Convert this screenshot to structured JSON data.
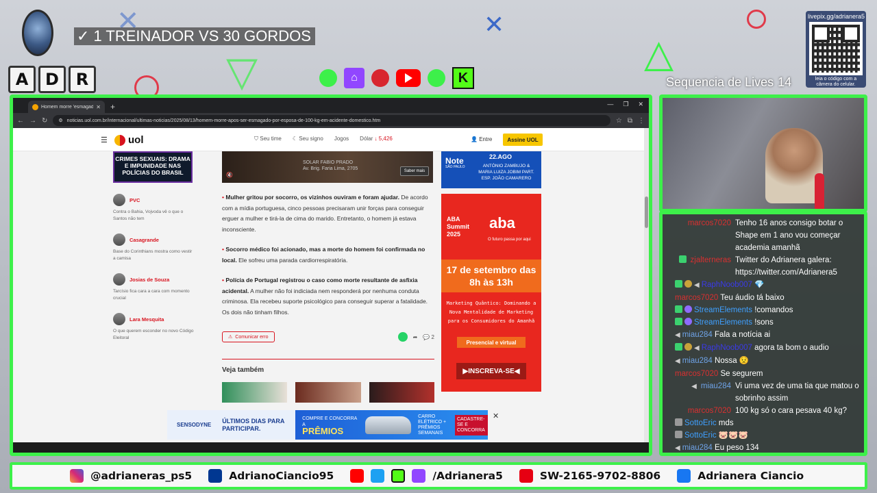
{
  "overlay": {
    "title_check": "✓",
    "title": "1 TREINADOR VS 30 GORDOS",
    "adr_letters": [
      "A",
      "D",
      "R"
    ],
    "qr_top": "livepix.gg/adrianera5",
    "qr_bottom": "leia o código com a câmera do celular.",
    "streak_label": "Sequencia de Lives",
    "streak_count": "14"
  },
  "browser": {
    "tab_title": "Homem morre 'esmagado' po",
    "url": "noticias.uol.com.br/internacional/ultimas-noticias/2025/08/13/homem-morre-apos-ser-esmagado-por-esposa-de-100-kg-em-acidente-domestico.htm"
  },
  "uol": {
    "logo": "uol",
    "nav": {
      "seu_time": "Seu time",
      "seu_signo": "Seu signo",
      "jogos": "Jogos",
      "dolar": "Dólar",
      "dolar_val": "↓ 5,426"
    },
    "entre": "Entre",
    "assine": "Assine UOL",
    "crimes_box": "CRIMES SEXUAIS: DRAMA E IMPUNIDADE NAS POLÍCIAS DO BRASIL",
    "authors": [
      {
        "name": "PVC",
        "desc": "Contra o Bahia, Vojvoda vê o que o Santos não tem"
      },
      {
        "name": "Casagrande",
        "desc": "Base do Corinthians mostra como vestir a camisa"
      },
      {
        "name": "Josias de Souza",
        "desc": "Tarcísio fica cara a cara com momento crucial"
      },
      {
        "name": "Lara Mesquita",
        "desc": "O que querem esconder no novo Código Eleitoral"
      }
    ],
    "video_caption_1": "SOLAR FABIO PRADO",
    "video_caption_2": "Av. Brig. Faria Lima, 2705",
    "saber_mais": "Saber mais",
    "p1_bold": "Mulher gritou por socorro, os vizinhos ouviram e foram ajudar.",
    "p1_rest": " De acordo com a mídia portuguesa, cinco pessoas precisaram unir forças para conseguir erguer a mulher e tirá-la de cima do marido. Entretanto, o homem já estava inconsciente.",
    "p2_bold": "Socorro médico foi acionado, mas a morte do homem foi confirmada no local.",
    "p2_rest": " Ele sofreu uma parada cardiorrespiratória.",
    "p3_bold": "Polícia de Portugal registrou o caso como morte resultante de asfixia acidental.",
    "p3_rest": " A mulher não foi indiciada nem responderá por nenhuma conduta criminosa. Ela recebeu suporte psicológico para conseguir superar a fatalidade. Os dois não tinham filhos.",
    "comunicar": "Comunicar erro",
    "comments": "2",
    "veja": "Veja também",
    "ad_note_logo": "Note",
    "ad_note_sub": "SÃO PAULO",
    "ad_note_date": "22.AGO",
    "ad_note_names": "ANTÓNIO ZAMBUJO & MARIA LUIZA JOBIM PART. ESP. JOÃO CAMARERO",
    "aba_summit": "ABA Summit 2025",
    "aba_logo": "aba",
    "aba_tag": "O futuro passa por aqui",
    "aba_date": "17 de setembro das 8h às 13h",
    "aba_mq": "Marketing Quântico: Dominando a Nova Mentalidade de Marketing para os Consumidores do Amanhã",
    "aba_pv": "Presencial e virtual",
    "aba_cta": "▶INSCREVA-SE◀",
    "bottom_ad_brand": "SENSODYNE",
    "bottom_ad_text": "ÚLTIMOS DIAS PARA PARTICIPAR.",
    "bottom_ad_promo": "COMPRE E CONCORRA A",
    "bottom_ad_premios": "PRÊMIOS",
    "bottom_ad_car": "CARRO ELÉTRICO + PRÊMIOS SEMANAIS",
    "bottom_ad_cta": "CADASTRE-SE E CONCORRA"
  },
  "chat": [
    {
      "user": "marcos7020",
      "color": "#d93030",
      "badges": [],
      "text": "Tenho 16 anos consigo botar o Shape em 1 ano vou começar academia amanhã"
    },
    {
      "user": "zjalterneras",
      "color": "#d93030",
      "badges": [
        "check"
      ],
      "text": "Twitter do Adrianera galera: https://twitter.com/Adrianera5"
    },
    {
      "user": "RaphNoob007",
      "color": "#3a3ae8",
      "badges": [
        "check",
        "coin",
        "spk"
      ],
      "text": "💎",
      "inline": true
    },
    {
      "user": "marcos7020",
      "color": "#d93030",
      "badges": [],
      "text": "Teu áudio tá baixo",
      "inline": true
    },
    {
      "user": "StreamElements",
      "color": "#3fa0ff",
      "badges": [
        "check",
        "mod"
      ],
      "text": "!comandos",
      "inline": true
    },
    {
      "user": "StreamElements",
      "color": "#3fa0ff",
      "badges": [
        "check",
        "mod"
      ],
      "text": "!sons",
      "inline": true
    },
    {
      "user": "miau284",
      "color": "#6fa3e8",
      "badges": [
        "spk"
      ],
      "text": "Fala a notícia ai",
      "inline": true
    },
    {
      "user": "RaphNoob007",
      "color": "#3a3ae8",
      "badges": [
        "check",
        "coin",
        "spk"
      ],
      "text": "agora ta bom o audio",
      "inline": true
    },
    {
      "user": "miau284",
      "color": "#6fa3e8",
      "badges": [
        "spk"
      ],
      "text": "Nossa 😟",
      "inline": true
    },
    {
      "user": "marcos7020",
      "color": "#d93030",
      "badges": [],
      "text": "Se segurem",
      "inline": true
    },
    {
      "user": "miau284",
      "color": "#6fa3e8",
      "badges": [
        "spk"
      ],
      "text": "Vi uma vez de uma tia que matou o sobrinho assim"
    },
    {
      "user": "marcos7020",
      "color": "#d93030",
      "badges": [],
      "text": "100 kg só o cara pesava 40 kg?"
    },
    {
      "user": "SottoEric",
      "color": "#3fa0ff",
      "badges": [
        "gray"
      ],
      "text": "mds",
      "inline": true
    },
    {
      "user": "SottoEric",
      "color": "#3fa0ff",
      "badges": [
        "gray"
      ],
      "text": "🐷🐷🐷",
      "inline": true
    },
    {
      "user": "miau284",
      "color": "#6fa3e8",
      "badges": [
        "spk"
      ],
      "text": "Eu peso 134",
      "inline": true
    }
  ],
  "socials": {
    "instagram": "@adrianeras_ps5",
    "psn": "AdrianoCiancio95",
    "multi": "/Adrianera5",
    "switch": "SW-2165-9702-8806",
    "facebook": "Adrianera Ciancio"
  },
  "colors": {
    "frame_green": "#3df04a",
    "uol_red": "#d8131e",
    "uol_yellow": "#f7c600",
    "twitch": "#9146ff",
    "youtube": "#ff0000",
    "kick": "#53fc18"
  }
}
